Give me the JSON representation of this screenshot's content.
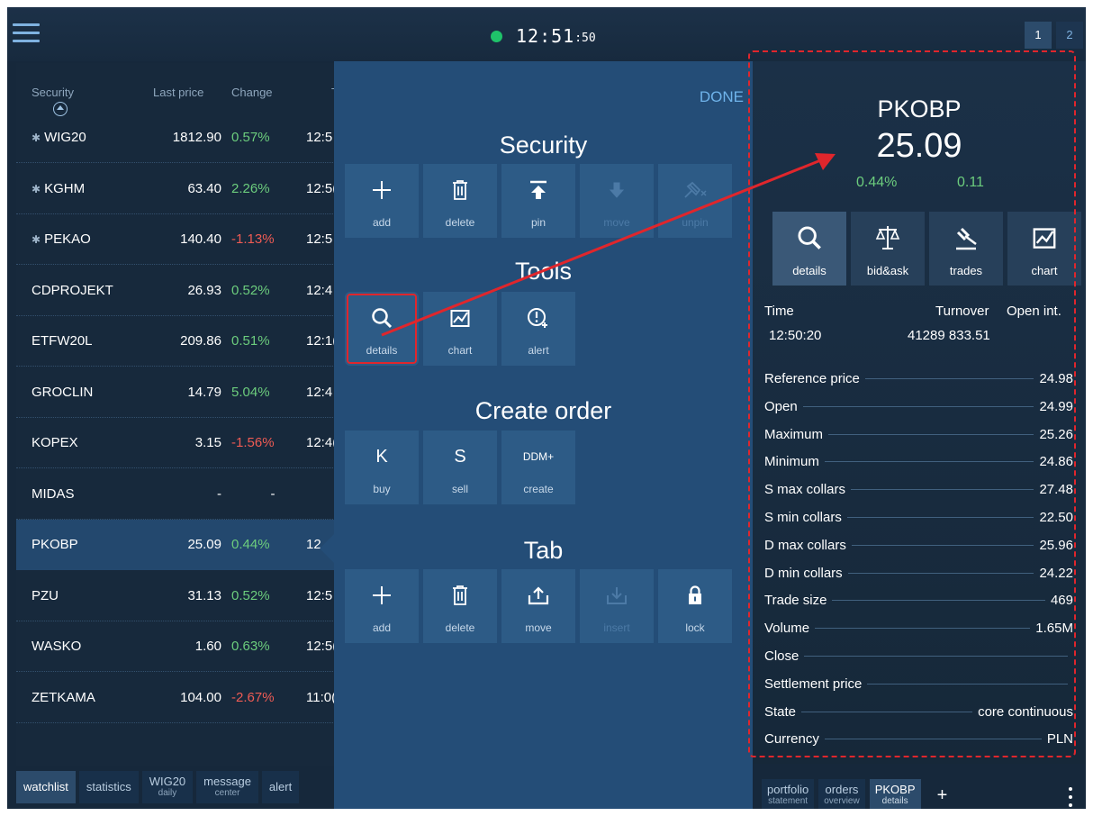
{
  "topbar": {
    "clock_big": "12:51",
    "clock_small": ":50",
    "page_tabs": [
      "1",
      "2"
    ]
  },
  "watchlist": {
    "columns": [
      "Security",
      "Last price",
      "Change",
      "T"
    ],
    "rows": [
      {
        "symbol": "WIG20",
        "pinned": true,
        "price": "1812.90",
        "change": "0.57%",
        "dir": "pos",
        "time": "12:5"
      },
      {
        "symbol": "KGHM",
        "pinned": true,
        "price": "63.40",
        "change": "2.26%",
        "dir": "pos",
        "time": "12:5("
      },
      {
        "symbol": "PEKAO",
        "pinned": true,
        "price": "140.40",
        "change": "-1.13%",
        "dir": "neg",
        "time": "12:5"
      },
      {
        "symbol": "CDPROJEKT",
        "pinned": false,
        "price": "26.93",
        "change": "0.52%",
        "dir": "pos",
        "time": "12:4"
      },
      {
        "symbol": "ETFW20L",
        "pinned": false,
        "price": "209.86",
        "change": "0.51%",
        "dir": "pos",
        "time": "12:1("
      },
      {
        "symbol": "GROCLIN",
        "pinned": false,
        "price": "14.79",
        "change": "5.04%",
        "dir": "pos",
        "time": "12:4"
      },
      {
        "symbol": "KOPEX",
        "pinned": false,
        "price": "3.15",
        "change": "-1.56%",
        "dir": "neg",
        "time": "12:4("
      },
      {
        "symbol": "MIDAS",
        "pinned": false,
        "price": "-",
        "change": "-",
        "dir": "flat",
        "time": ""
      },
      {
        "symbol": "PKOBP",
        "pinned": false,
        "price": "25.09",
        "change": "0.44%",
        "dir": "pos",
        "time": "12."
      },
      {
        "symbol": "PZU",
        "pinned": false,
        "price": "31.13",
        "change": "0.52%",
        "dir": "pos",
        "time": "12:5"
      },
      {
        "symbol": "WASKO",
        "pinned": false,
        "price": "1.60",
        "change": "0.63%",
        "dir": "pos",
        "time": "12:5("
      },
      {
        "symbol": "ZETKAMA",
        "pinned": false,
        "price": "104.00",
        "change": "-2.67%",
        "dir": "neg",
        "time": "11:0("
      }
    ]
  },
  "bottom_tabs": [
    {
      "l1": "watchlist",
      "l2": ""
    },
    {
      "l1": "statistics",
      "l2": ""
    },
    {
      "l1": "WIG20",
      "l2": "daily"
    },
    {
      "l1": "message",
      "l2": "center"
    },
    {
      "l1": "alert",
      "l2": ""
    }
  ],
  "tools_panel": {
    "done": "DONE",
    "security_title": "Security",
    "security_buttons": [
      "add",
      "delete",
      "pin",
      "move",
      "unpin"
    ],
    "tools_title": "Tools",
    "tools_buttons": [
      "details",
      "chart",
      "alert"
    ],
    "order_title": "Create order",
    "order_buttons": [
      {
        "icon": "K",
        "label": "buy"
      },
      {
        "icon": "S",
        "label": "sell"
      },
      {
        "icon": "DDM+",
        "label": "create"
      }
    ],
    "tab_title": "Tab",
    "tab_buttons": [
      "add",
      "delete",
      "move",
      "insert",
      "lock"
    ]
  },
  "details": {
    "symbol": "PKOBP",
    "price": "25.09",
    "change_pct": "0.44%",
    "change_abs": "0.11",
    "tabs": [
      "details",
      "bid&ask",
      "trades",
      "chart"
    ],
    "time_label": "Time",
    "time_value": "12:50:20",
    "turnover_label": "Turnover",
    "turnover_value": "41289 833.51",
    "open_int_label": "Open int.",
    "stats": [
      {
        "k": "Reference price",
        "v": "24.98"
      },
      {
        "k": "Open",
        "v": "24.99"
      },
      {
        "k": "Maximum",
        "v": "25.26"
      },
      {
        "k": "Minimum",
        "v": "24.86"
      },
      {
        "k": "S max collars",
        "v": "27.48"
      },
      {
        "k": "S min collars",
        "v": "22.50"
      },
      {
        "k": "D max collars",
        "v": "25.96"
      },
      {
        "k": "D min collars",
        "v": "24.22"
      },
      {
        "k": "Trade size",
        "v": "469"
      },
      {
        "k": "Volume",
        "v": "1.65M"
      },
      {
        "k": "Close",
        "v": ""
      },
      {
        "k": "Settlement price",
        "v": ""
      },
      {
        "k": "State",
        "v": "core continuous"
      },
      {
        "k": "Currency",
        "v": "PLN"
      }
    ]
  },
  "right_tabs": [
    {
      "l1": "portfolio",
      "l2": "statement"
    },
    {
      "l1": "orders",
      "l2": "overview"
    },
    {
      "l1": "PKOBP",
      "l2": "details"
    }
  ],
  "right_plus": "+",
  "colors": {
    "background": "#16283b",
    "panel": "#244d77",
    "positive": "#6ccd7d",
    "negative": "#ef5b54",
    "accent": "#6fb3ea",
    "annotation": "#e0262c"
  }
}
